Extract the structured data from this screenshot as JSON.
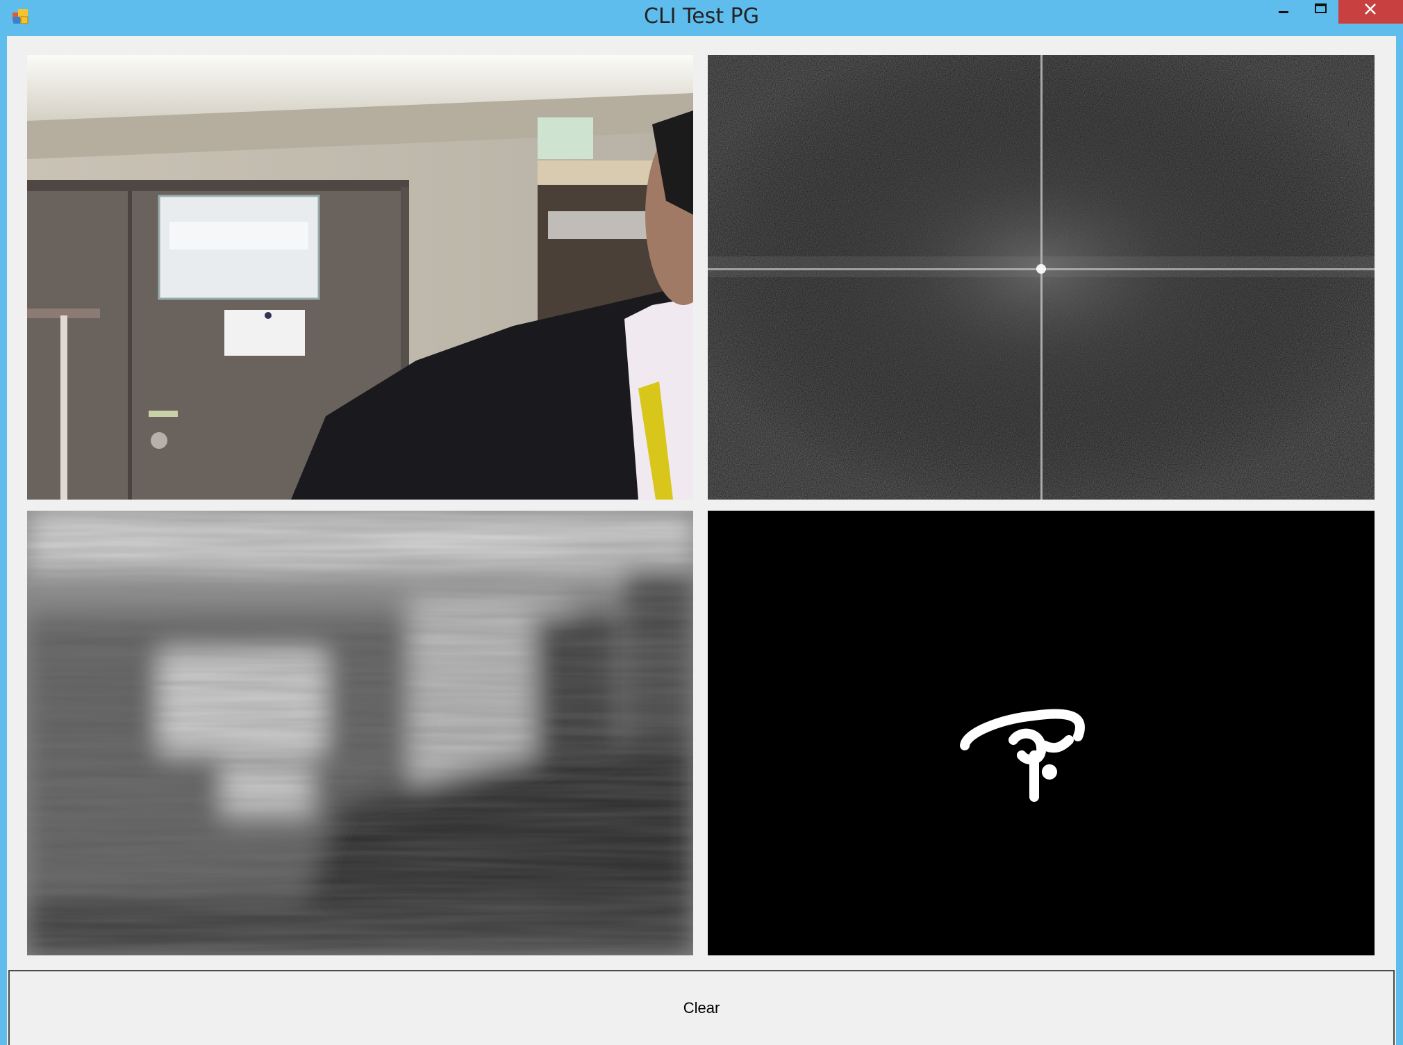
{
  "window": {
    "title": "CLI Test PG",
    "titlebar_color": "#5fbdee",
    "close_color": "#c94040",
    "icons": [
      "app-icon",
      "minimize-icon",
      "maximize-icon",
      "close-icon"
    ]
  },
  "panels": [
    {
      "id": "camera",
      "content": "webcam photo"
    },
    {
      "id": "fft",
      "content": "frequency spectrum image"
    },
    {
      "id": "inverse",
      "content": "blurred grayscale image"
    },
    {
      "id": "mask",
      "content": "binary mask image"
    }
  ],
  "buttons": {
    "clear_label": "Clear"
  }
}
